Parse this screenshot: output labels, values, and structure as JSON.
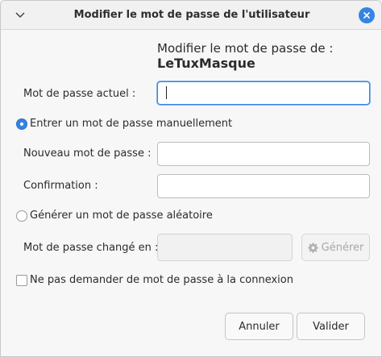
{
  "window": {
    "title": "Modifier le mot de passe de l'utilisateur"
  },
  "heading": {
    "line1": "Modifier le mot de passe de :",
    "username": "LeTuxMasque"
  },
  "form": {
    "current_password_label": "Mot de passe actuel :",
    "current_password_value": "",
    "manual_radio_label": "Entrer un mot de passe manuellement",
    "manual_radio_checked": true,
    "new_password_label": "Nouveau mot de passe :",
    "new_password_value": "",
    "confirm_label": "Confirmation :",
    "confirm_value": "",
    "random_radio_label": "Générer un mot de passe aléatoire",
    "random_radio_checked": false,
    "changed_to_label": "Mot de passe changé en :",
    "changed_to_value": "",
    "generate_button": "Générer",
    "no_password_login_label": "Ne pas demander de mot de passe à la connexion",
    "no_password_login_checked": false
  },
  "actions": {
    "cancel_label": "Annuler",
    "validate_label": "Valider"
  },
  "colors": {
    "accent": "#3584e4"
  },
  "icons": {
    "titlebar_left": "chevron-down-icon",
    "titlebar_right": "close-icon",
    "generate": "gear-icon"
  }
}
